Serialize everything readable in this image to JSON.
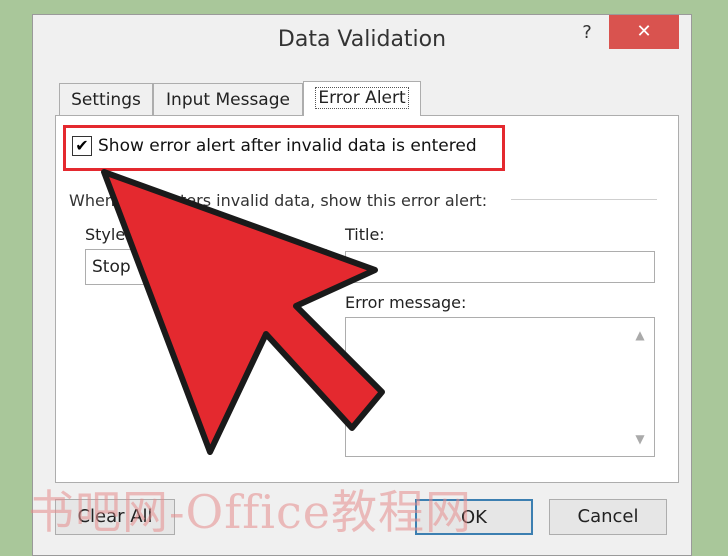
{
  "dialog": {
    "title": "Data Validation",
    "help_label": "?",
    "close_label": "✕"
  },
  "tabs": [
    {
      "label": "Settings",
      "active": false
    },
    {
      "label": "Input Message",
      "active": false
    },
    {
      "label": "Error Alert",
      "active": true
    }
  ],
  "error_alert": {
    "show_alert_label": "Show error alert after invalid data is entered",
    "show_alert_checked": true,
    "section_label": "When user enters invalid data, show this error alert:",
    "style_label": "Style:",
    "style_value": "Stop",
    "title_label": "Title:",
    "title_value": "",
    "message_label": "Error message:",
    "message_value": ""
  },
  "buttons": {
    "clear_all": "Clear All",
    "ok": "OK",
    "cancel": "Cancel"
  },
  "overlay": {
    "arrow_color": "#e4292f",
    "watermark": "书吧网-Office教程网"
  }
}
